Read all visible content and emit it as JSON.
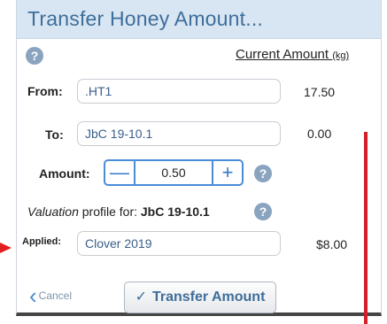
{
  "dialog": {
    "title": "Transfer Honey Amount...",
    "current_header": "Current Amount ",
    "current_unit": "(kg)",
    "help_glyph": "?"
  },
  "from": {
    "label": "From:",
    "value": ".HT1",
    "amount": "17.50"
  },
  "to": {
    "label": "To:",
    "value": "JbC 19-10.1",
    "amount": "0.00"
  },
  "amount": {
    "label": "Amount:",
    "value": "0.50",
    "minus_glyph": "—",
    "plus_glyph": "+"
  },
  "valuation": {
    "prefix_italic": "Valuation",
    "text": " profile for: ",
    "hive": "JbC 19-10.1"
  },
  "applied": {
    "label": "Applied:",
    "value": "Clover 2019",
    "price": "$8.00"
  },
  "actions": {
    "cancel_label": "Cancel",
    "transfer_label": "Transfer Amount"
  },
  "colors": {
    "title_bar": "#d8e6f3",
    "title_text": "#3f6e9a",
    "accent": "#4a8cd8",
    "annotation": "#d4202a"
  }
}
